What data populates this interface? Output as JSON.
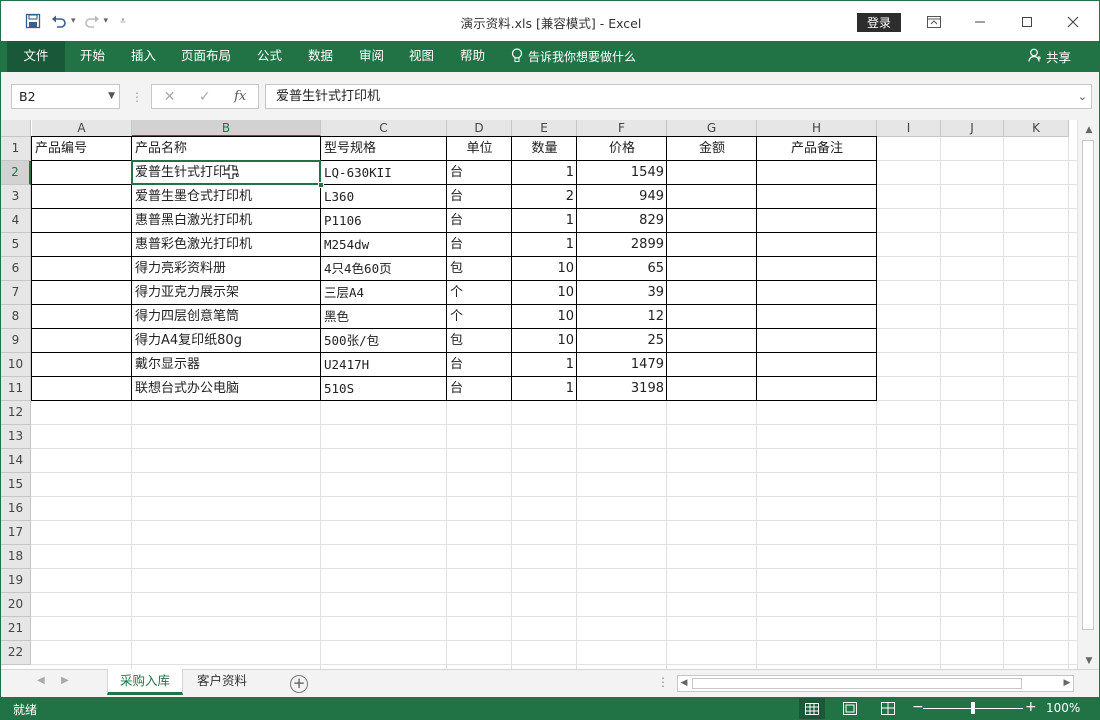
{
  "window": {
    "title": "演示资料.xls  [兼容模式]  -  Excel",
    "login_label": "登录"
  },
  "ribbon": {
    "file_label": "文件",
    "tabs": [
      {
        "label": "开始"
      },
      {
        "label": "插入"
      },
      {
        "label": "页面布局"
      },
      {
        "label": "公式"
      },
      {
        "label": "数据"
      },
      {
        "label": "审阅"
      },
      {
        "label": "视图"
      },
      {
        "label": "帮助"
      }
    ],
    "tell_me": "告诉我你想要做什么",
    "share_label": "共享"
  },
  "formula_bar": {
    "name_box": "B2",
    "formula": "爱普生针式打印机"
  },
  "columns": [
    "A",
    "B",
    "C",
    "D",
    "E",
    "F",
    "G",
    "H",
    "I",
    "J",
    "K"
  ],
  "row_numbers": [
    "1",
    "2",
    "3",
    "4",
    "5",
    "6",
    "7",
    "8",
    "9",
    "10",
    "11",
    "12",
    "13",
    "14",
    "15",
    "16",
    "17",
    "18",
    "19",
    "20",
    "21",
    "22"
  ],
  "table": {
    "headers": [
      "产品编号",
      "产品名称",
      "型号规格",
      "单位",
      "数量",
      "价格",
      "金额",
      "产品备注"
    ],
    "rows": [
      [
        "",
        "爱普生针式打印机",
        "LQ-630KII",
        "台",
        "1",
        "1549",
        "",
        ""
      ],
      [
        "",
        "爱普生墨仓式打印机",
        "L360",
        "台",
        "2",
        "949",
        "",
        ""
      ],
      [
        "",
        "惠普黑白激光打印机",
        "P1106",
        "台",
        "1",
        "829",
        "",
        ""
      ],
      [
        "",
        "惠普彩色激光打印机",
        "M254dw",
        "台",
        "1",
        "2899",
        "",
        ""
      ],
      [
        "",
        "得力亮彩资料册",
        "4只4色60页",
        "包",
        "10",
        "65",
        "",
        ""
      ],
      [
        "",
        "得力亚克力展示架",
        "三层A4",
        "个",
        "10",
        "39",
        "",
        ""
      ],
      [
        "",
        "得力四层创意笔筒",
        "黑色",
        "个",
        "10",
        "12",
        "",
        ""
      ],
      [
        "",
        "得力A4复印纸80g",
        "500张/包",
        "包",
        "10",
        "25",
        "",
        ""
      ],
      [
        "",
        "戴尔显示器",
        "U2417H",
        "台",
        "1",
        "1479",
        "",
        ""
      ],
      [
        "",
        "联想台式办公电脑",
        "510S",
        "台",
        "1",
        "3198",
        "",
        ""
      ]
    ]
  },
  "sheets": [
    {
      "label": "采购入库",
      "active": true
    },
    {
      "label": "客户资料",
      "active": false
    }
  ],
  "status": {
    "ready": "就绪",
    "zoom": "100%"
  },
  "colors": {
    "accent": "#217346"
  }
}
